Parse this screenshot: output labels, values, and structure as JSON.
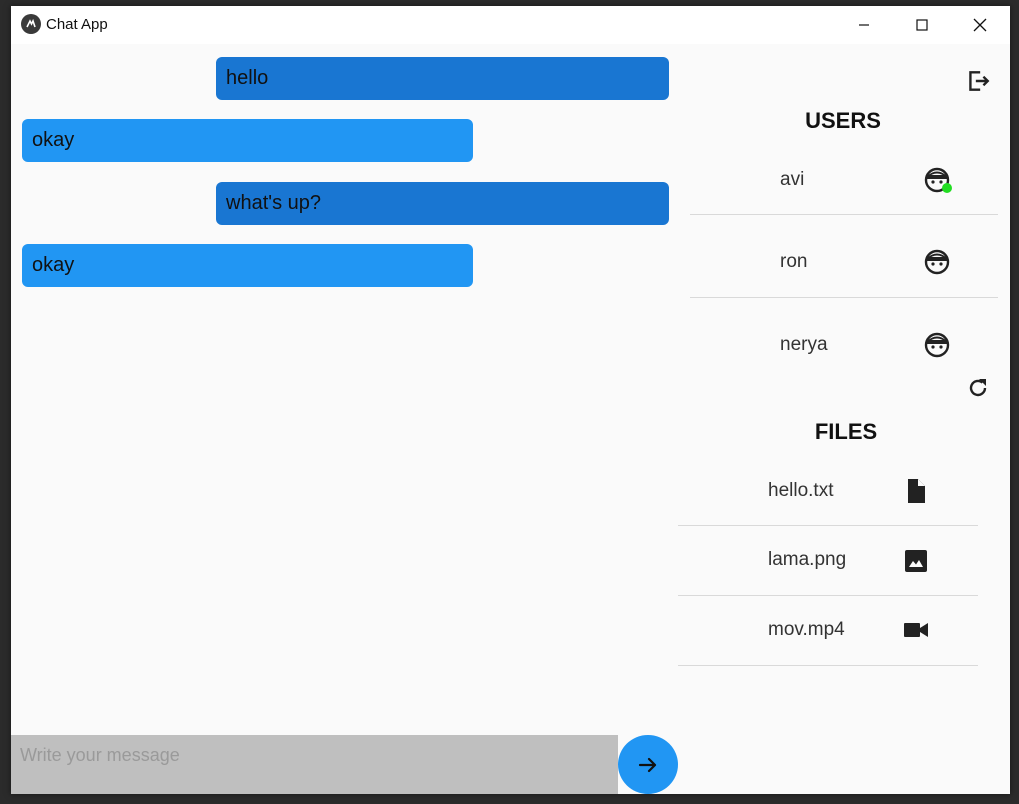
{
  "window": {
    "title": "Chat App"
  },
  "messages": [
    {
      "sender": "me",
      "text": "hello"
    },
    {
      "sender": "other",
      "text": "okay"
    },
    {
      "sender": "me",
      "text": "what's up?"
    },
    {
      "sender": "other",
      "text": "okay"
    }
  ],
  "composer": {
    "placeholder": "Write your message",
    "value": ""
  },
  "users": {
    "heading": "USERS",
    "items": [
      {
        "name": "avi",
        "online": true,
        "icon": "avatar-icon"
      },
      {
        "name": "ron",
        "online": false,
        "icon": "avatar-icon"
      },
      {
        "name": "nerya",
        "online": false,
        "icon": "avatar-icon"
      }
    ]
  },
  "files": {
    "heading": "FILES",
    "items": [
      {
        "name": "hello.txt",
        "icon": "document-icon"
      },
      {
        "name": "lama.png",
        "icon": "image-icon"
      },
      {
        "name": "mov.mp4",
        "icon": "video-icon"
      }
    ]
  },
  "colors": {
    "my_bubble": "#1976d2",
    "their_bubble": "#2196f3",
    "send_button": "#2196f3",
    "online_dot": "#22dd22"
  }
}
